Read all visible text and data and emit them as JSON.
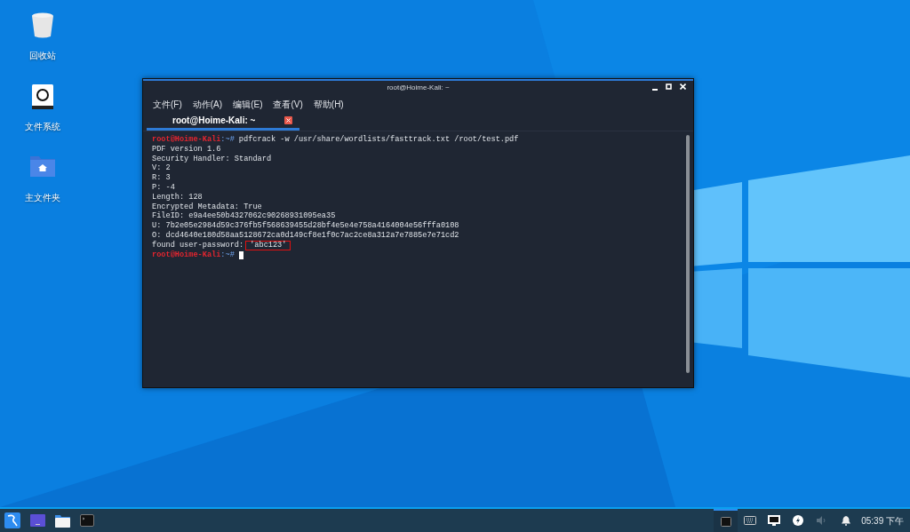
{
  "desktop_icons": [
    {
      "kind": "trash",
      "label": "回收站"
    },
    {
      "kind": "drive",
      "label": "文件系统"
    },
    {
      "kind": "home",
      "label": "主文件夹"
    }
  ],
  "window": {
    "title": "root@Hoime-Kali: ~",
    "menu": [
      "文件(F)",
      "动作(A)",
      "编辑(E)",
      "查看(V)",
      "帮助(H)"
    ],
    "tabs": [
      {
        "label": "root@Hoime-Kali: ~",
        "selected": true
      }
    ],
    "lines": [
      {
        "kind": "prompt",
        "user": "root@Hoime-Kali",
        "path": ":~#",
        "command": "pdfcrack -w /usr/share/wordlists/fasttrack.txt /root/test.pdf",
        "cursor": false
      },
      {
        "kind": "output",
        "text": "PDF version 1.6"
      },
      {
        "kind": "output",
        "text": "Security Handler: Standard"
      },
      {
        "kind": "output",
        "text": "V: 2"
      },
      {
        "kind": "output",
        "text": "R: 3"
      },
      {
        "kind": "output",
        "text": "P: -4"
      },
      {
        "kind": "output",
        "text": "Length: 128"
      },
      {
        "kind": "output",
        "text": "Encrypted Metadata: True"
      },
      {
        "kind": "output",
        "text": "FileID: e9a4ee50b4327062c90268931095ea35"
      },
      {
        "kind": "output",
        "text": "U: 7b2e05e2984d59c376fb5f568639455d28bf4e5e4e758a4164004e56fffa0108"
      },
      {
        "kind": "output",
        "text": "O: dcd4640e180d58aa5128672ca0d149cf8e1f0c7ac2ce8a312a7e7885e7e71cd2"
      },
      {
        "kind": "found",
        "label": "found user-password:",
        "value": "'abc123'"
      },
      {
        "kind": "prompt",
        "user": "root@Hoime-Kali",
        "path": ":~#",
        "cursor": true
      }
    ]
  },
  "taskbar": {
    "apps": [
      {
        "kind": "kali"
      },
      {
        "kind": "workspace"
      },
      {
        "kind": "folder"
      },
      {
        "kind": "terminal"
      }
    ],
    "tray": [
      {
        "kind": "window",
        "active": true
      },
      {
        "kind": "keyboard"
      },
      {
        "kind": "network"
      },
      {
        "kind": "power"
      },
      {
        "kind": "volume"
      },
      {
        "kind": "bell"
      }
    ],
    "clock": "05:39 下午"
  }
}
